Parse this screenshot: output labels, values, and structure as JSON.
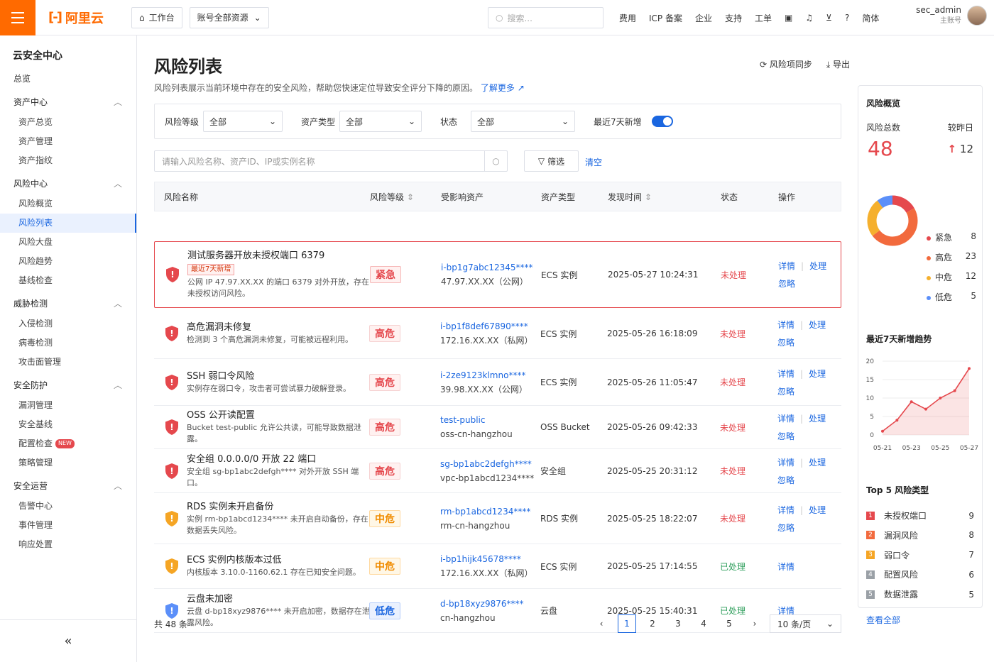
{
  "topbar": {
    "logo_text": "阿里云",
    "workbench": "工作台",
    "account_scope": "账号全部资源",
    "search_placeholder": "搜索...",
    "links": [
      "费用",
      "ICP 备案",
      "企业",
      "支持",
      "工单"
    ],
    "lang": "简体",
    "user_name": "sec_admin",
    "user_role": "主账号"
  },
  "sidebar": {
    "title": "云安全中心",
    "overview": "总览",
    "groups": [
      {
        "label": "资产中心",
        "items": [
          "资产总览",
          "资产管理",
          "资产指纹"
        ]
      },
      {
        "label": "风险中心",
        "items": [
          "风险概览",
          "风险列表",
          "风险大盘",
          "风险趋势",
          "基线检查"
        ]
      },
      {
        "label": "威胁检测",
        "items": [
          "入侵检测",
          "病毒检测",
          "攻击面管理"
        ]
      },
      {
        "label": "安全防护",
        "items": [
          "漏洞管理",
          "安全基线",
          "配置检查",
          "策略管理"
        ]
      },
      {
        "label": "安全运营",
        "items": [
          "告警中心",
          "事件管理",
          "响应处置"
        ]
      }
    ],
    "new_badge": "NEW",
    "active_item": "风险列表"
  },
  "page": {
    "title": "风险列表",
    "description": "风险列表展示当前环境中存在的安全风险，帮助您快速定位导致安全评分下降的原因。",
    "learn_more": "了解更多",
    "sync_label": "风险项同步",
    "export_label": "导出"
  },
  "filters": {
    "level_label": "风险等级",
    "level_value": "全部",
    "asset_type_label": "资产类型",
    "asset_type_value": "全部",
    "status_label": "状态",
    "status_value": "全部",
    "recent_label": "最近7天新增",
    "search_placeholder": "请输入风险名称、资产ID、IP或实例名称",
    "filter_btn": "筛选",
    "clear_btn": "清空"
  },
  "table": {
    "columns": [
      "风险名称",
      "风险等级",
      "受影响资产",
      "资产类型",
      "发现时间",
      "状态",
      "操作"
    ],
    "rows": [
      {
        "name": "测试服务器开放未授权端口 6379",
        "tag": "最近7天新增",
        "desc": "公网 IP 47.97.XX.XX 的端口 6379 对外开放，存在未授权访问风险。",
        "level": "紧急",
        "level_class": "urgent",
        "asset_id": "i-bp1g7abc12345****",
        "asset_sub": "47.97.XX.XX（公网）",
        "type": "ECS 实例",
        "time": "2025-05-27 10:24:31",
        "status": "未处理",
        "done": false,
        "shield": "#e5484d"
      },
      {
        "name": "高危漏洞未修复",
        "tag": "",
        "desc": "检测到 3 个高危漏洞未修复，可能被远程利用。",
        "level": "高危",
        "level_class": "high",
        "asset_id": "i-bp1f8def67890****",
        "asset_sub": "172.16.XX.XX（私网）",
        "type": "ECS 实例",
        "time": "2025-05-26 16:18:09",
        "status": "未处理",
        "done": false,
        "shield": "#e5484d"
      },
      {
        "name": "SSH 弱口令风险",
        "tag": "",
        "desc": "实例存在弱口令，攻击者可尝试暴力破解登录。",
        "level": "高危",
        "level_class": "high",
        "asset_id": "i-2ze9123klmno****",
        "asset_sub": "39.98.XX.XX（公网）",
        "type": "ECS 实例",
        "time": "2025-05-26 11:05:47",
        "status": "未处理",
        "done": false,
        "shield": "#e5484d"
      },
      {
        "name": "OSS 公开读配置",
        "tag": "",
        "desc": "Bucket test-public 允许公共读，可能导致数据泄露。",
        "level": "高危",
        "level_class": "high",
        "asset_id": "test-public",
        "asset_sub": "oss-cn-hangzhou",
        "type": "OSS Bucket",
        "time": "2025-05-26 09:42:33",
        "status": "未处理",
        "done": false,
        "shield": "#e5484d"
      },
      {
        "name": "安全组 0.0.0.0/0 开放 22 端口",
        "tag": "",
        "desc": "安全组 sg-bp1abc2defgh**** 对外开放 SSH 端口。",
        "level": "高危",
        "level_class": "high",
        "asset_id": "sg-bp1abc2defgh****",
        "asset_sub": "vpc-bp1abcd1234****",
        "type": "安全组",
        "time": "2025-05-25 20:31:12",
        "status": "未处理",
        "done": false,
        "shield": "#e5484d"
      },
      {
        "name": "RDS 实例未开启备份",
        "tag": "",
        "desc": "实例 rm-bp1abcd1234**** 未开启自动备份，存在数据丢失风险。",
        "level": "中危",
        "level_class": "mid",
        "asset_id": "rm-bp1abcd1234****",
        "asset_sub": "rm-cn-hangzhou",
        "type": "RDS 实例",
        "time": "2025-05-25 18:22:07",
        "status": "未处理",
        "done": false,
        "shield": "#f5a524"
      },
      {
        "name": "ECS 实例内核版本过低",
        "tag": "",
        "desc": "内核版本 3.10.0-1160.62.1 存在已知安全问题。",
        "level": "中危",
        "level_class": "mid",
        "asset_id": "i-bp1hijk45678****",
        "asset_sub": "172.16.XX.XX（私网）",
        "type": "ECS 实例",
        "time": "2025-05-25 17:14:55",
        "status": "已处理",
        "done": true,
        "shield": "#f5a524"
      },
      {
        "name": "云盘未加密",
        "tag": "",
        "desc": "云盘 d-bp18xyz9876**** 未开启加密，数据存在泄露风险。",
        "level": "低危",
        "level_class": "low",
        "asset_id": "d-bp18xyz9876****",
        "asset_sub": "cn-hangzhou",
        "type": "云盘",
        "time": "2025-05-25 15:40:31",
        "status": "已处理",
        "done": true,
        "shield": "#5b8ff9"
      }
    ],
    "op_detail": "详情",
    "op_handle": "处理",
    "op_ignore": "忽略"
  },
  "pagination": {
    "total": "共 48 条",
    "pages": [
      "1",
      "2",
      "3",
      "4",
      "5"
    ],
    "current": "1",
    "page_size": "10 条/页"
  },
  "overview": {
    "title": "风险概览",
    "total_label": "风险总数",
    "total": "48",
    "compare_label": "较昨日",
    "compare_value": "12",
    "donut": [
      {
        "name": "紧急",
        "value": 8,
        "color": "#e5484d"
      },
      {
        "name": "高危",
        "value": 23,
        "color": "#f26a3d"
      },
      {
        "name": "中危",
        "value": 12,
        "color": "#f5b02e"
      },
      {
        "name": "低危",
        "value": 5,
        "color": "#5b8ff9"
      }
    ],
    "trend_title": "最近7天新增趋势",
    "top5_title": "Top 5 风险类型",
    "top5": [
      {
        "rank": "1",
        "name": "未授权端口",
        "value": "9",
        "color": "#e5484d"
      },
      {
        "rank": "2",
        "name": "漏洞风险",
        "value": "8",
        "color": "#f26a3d"
      },
      {
        "rank": "3",
        "name": "弱口令",
        "value": "7",
        "color": "#f5a524"
      },
      {
        "rank": "4",
        "name": "配置风险",
        "value": "6",
        "color": "#9aa0a6"
      },
      {
        "rank": "5",
        "name": "数据泄露",
        "value": "5",
        "color": "#9aa0a6"
      }
    ],
    "view_all": "查看全部"
  },
  "chart_data": {
    "type": "area",
    "title": "最近7天新增趋势",
    "x": [
      "05-21",
      "05-22",
      "05-23",
      "05-24",
      "05-25",
      "05-26",
      "05-27"
    ],
    "x_ticks": [
      "05-21",
      "05-23",
      "05-25",
      "05-27"
    ],
    "values": [
      1,
      4,
      9,
      7,
      10,
      12,
      18
    ],
    "ylim": [
      0,
      20
    ],
    "y_ticks": [
      0,
      5,
      10,
      15,
      20
    ],
    "color": "#e5484d"
  }
}
